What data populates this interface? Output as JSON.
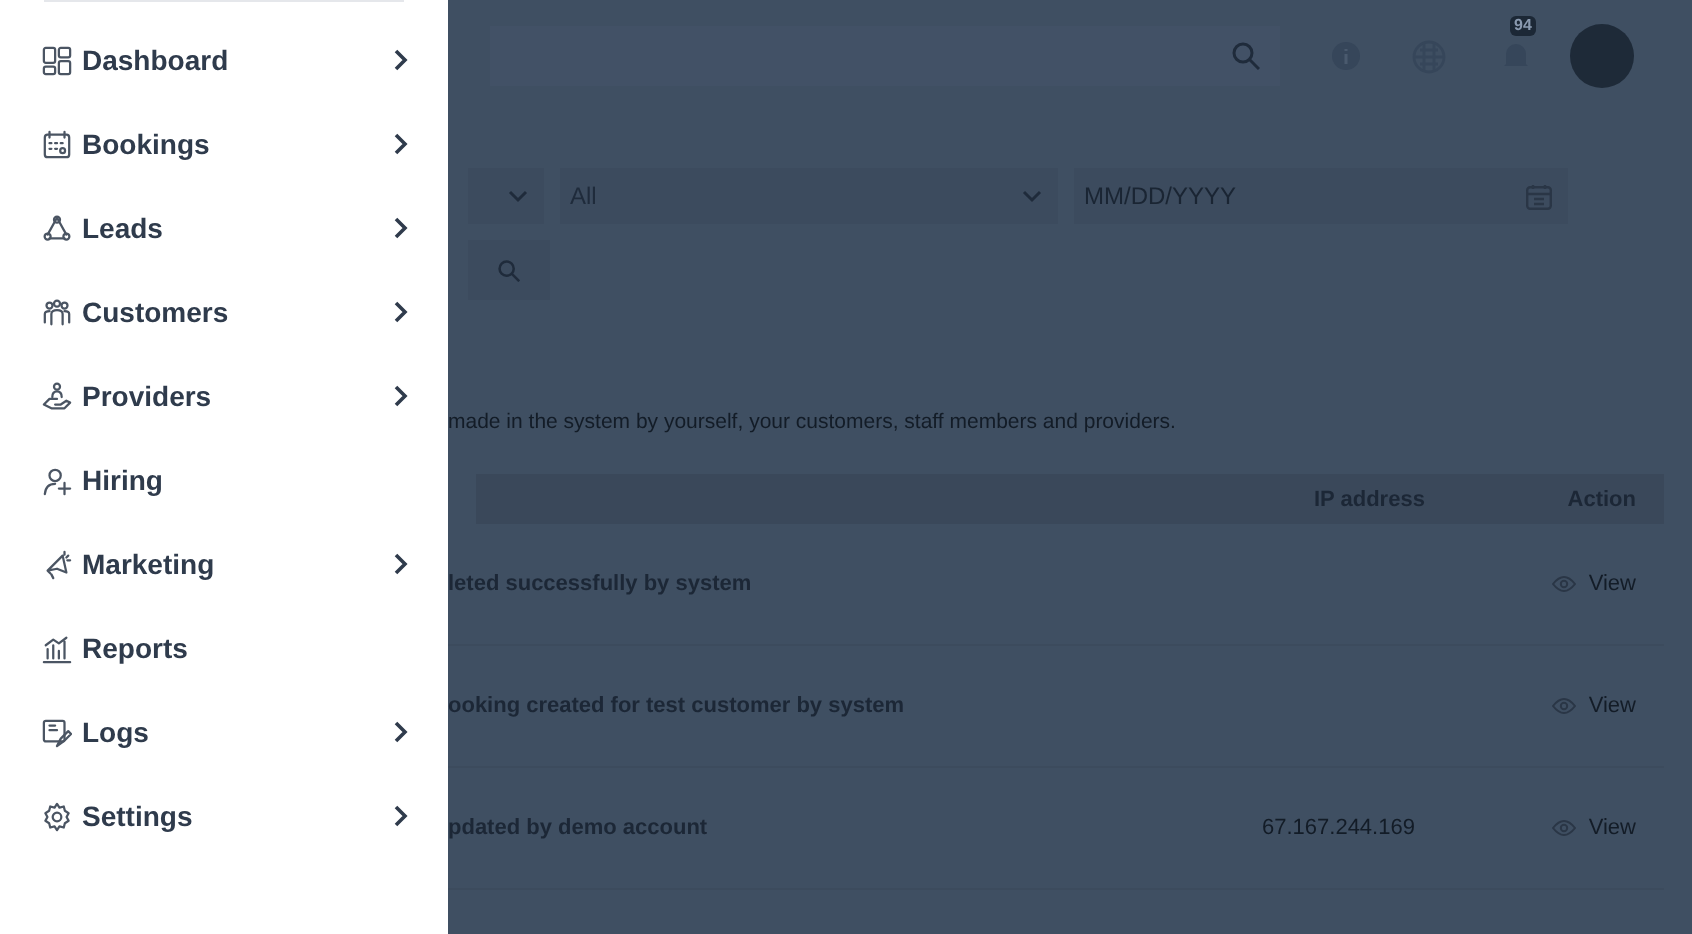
{
  "sidebar": {
    "items": [
      {
        "label": "Dashboard",
        "has_submenu": true
      },
      {
        "label": "Bookings",
        "has_submenu": true
      },
      {
        "label": "Leads",
        "has_submenu": true
      },
      {
        "label": "Customers",
        "has_submenu": true
      },
      {
        "label": "Providers",
        "has_submenu": true
      },
      {
        "label": "Hiring",
        "has_submenu": false
      },
      {
        "label": "Marketing",
        "has_submenu": true
      },
      {
        "label": "Reports",
        "has_submenu": false
      },
      {
        "label": "Logs",
        "has_submenu": true
      },
      {
        "label": "Settings",
        "has_submenu": true
      }
    ]
  },
  "header": {
    "notification_count": "94"
  },
  "filters": [
    {
      "kind": "select"
    },
    {
      "kind": "select",
      "value": "All"
    },
    {
      "kind": "date",
      "placeholder": "MM/DD/YYYY"
    }
  ],
  "description": "made in the system by yourself, your customers, staff members and providers.",
  "table": {
    "columns": [
      "IP address",
      "Action"
    ],
    "rows": [
      {
        "column_1": "leted successfully by system",
        "ip_address": "",
        "action": "View"
      },
      {
        "column_1": "ooking created for test customer by system",
        "ip_address": "",
        "action": "View"
      },
      {
        "column_1": "pdated by demo account",
        "ip_address": "67.167.244.169",
        "action": "View"
      }
    ]
  }
}
